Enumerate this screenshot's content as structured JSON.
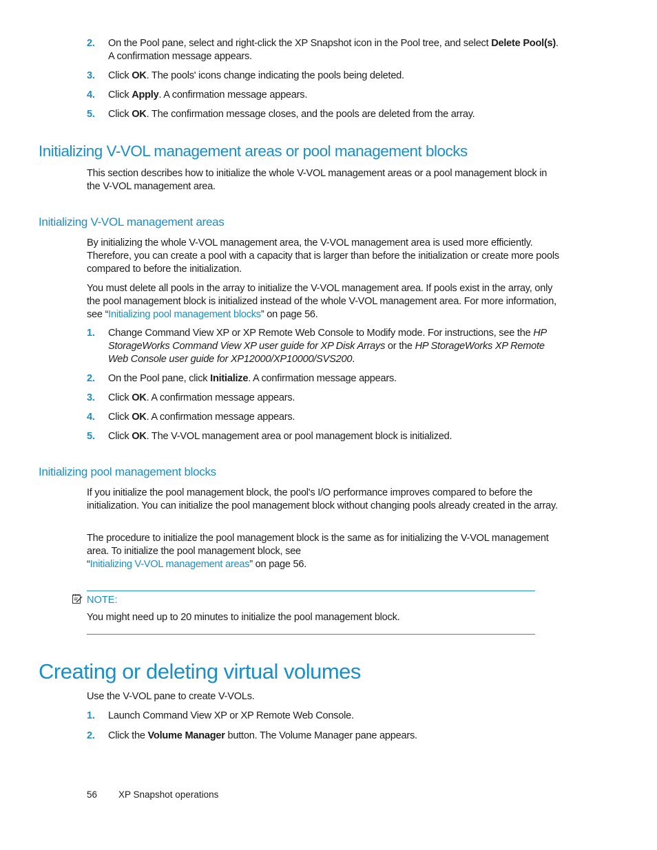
{
  "top_steps": [
    {
      "num": "2.",
      "pre": "On the Pool pane, select and right-click the XP Snapshot icon in the Pool tree, and select ",
      "bold": "Delete Pool(s)",
      "post": ". A confirmation message appears."
    },
    {
      "num": "3.",
      "pre": "Click ",
      "bold": "OK",
      "post": ". The pools' icons change indicating the pools being deleted."
    },
    {
      "num": "4.",
      "pre": "Click ",
      "bold": "Apply",
      "post": ". A confirmation message appears."
    },
    {
      "num": "5.",
      "pre": "Click ",
      "bold": "OK",
      "post": ". The confirmation message closes, and the pools are deleted from the array."
    }
  ],
  "section_init": {
    "heading": "Initializing V-VOL management areas or pool management blocks",
    "intro": "This section describes how to initialize the whole V-VOL management areas or a pool management block in the V-VOL management area."
  },
  "subsection_vvol": {
    "heading": "Initializing V-VOL management areas",
    "para1": "By initializing the whole V-VOL management area, the V-VOL management area is used more efficiently. Therefore, you can create a pool with a capacity that is larger than before the initialization or create more pools compared to before the initialization.",
    "para2_pre": "You must delete all pools in the array to initialize the V-VOL management area. If pools exist in the array, only the pool management block is initialized instead of the whole V-VOL management area. For more information, see “",
    "para2_link": "Initializing pool management blocks",
    "para2_post": "” on page 56.",
    "steps": [
      {
        "num": "1.",
        "pre": "Change Command View XP or XP Remote Web Console to Modify mode. For instructions, see the ",
        "italic1": "HP StorageWorks Command View XP user guide for XP Disk Arrays",
        "mid": " or the ",
        "italic2": "HP StorageWorks XP Remote Web Console user guide for XP12000/XP10000/SVS200",
        "post": "."
      },
      {
        "num": "2.",
        "pre": "On the Pool pane, click ",
        "bold": "Initialize",
        "post": ". A confirmation message appears."
      },
      {
        "num": "3.",
        "pre": "Click ",
        "bold": "OK",
        "post": ". A confirmation message appears."
      },
      {
        "num": "4.",
        "pre": "Click ",
        "bold": "OK",
        "post": ". A confirmation message appears."
      },
      {
        "num": "5.",
        "pre": "Click ",
        "bold": "OK",
        "post": ". The V-VOL management area or pool management block is initialized."
      }
    ]
  },
  "subsection_pool": {
    "heading": "Initializing pool management blocks",
    "para1": "If you initialize the pool management block, the pool's I/O performance improves compared to before the initialization. You can initialize the pool management block without changing pools already created in the array.",
    "para2_pre": "The procedure to initialize the pool management block is the same as for initializing the V-VOL management area. To initialize the pool management block, see",
    "para2_quote_open": "“",
    "para2_link": "Initializing V-VOL management areas",
    "para2_post": "” on page 56."
  },
  "note": {
    "icon": "note-pad-icon",
    "label": "NOTE:",
    "text": "You might need up to 20 minutes to initialize the pool management block."
  },
  "section_create": {
    "heading": "Creating or deleting virtual volumes",
    "intro": "Use the V-VOL pane to create V-VOLs.",
    "steps": [
      {
        "num": "1.",
        "pre": "Launch Command View XP or XP Remote Web Console.",
        "bold": "",
        "post": ""
      },
      {
        "num": "2.",
        "pre": "Click the ",
        "bold": "Volume Manager",
        "post": " button. The Volume Manager pane appears."
      }
    ]
  },
  "footer": {
    "page_number": "56",
    "chapter": "XP Snapshot operations"
  },
  "colors": {
    "accent": "#1b8ec6",
    "text": "#1c1c1c"
  }
}
